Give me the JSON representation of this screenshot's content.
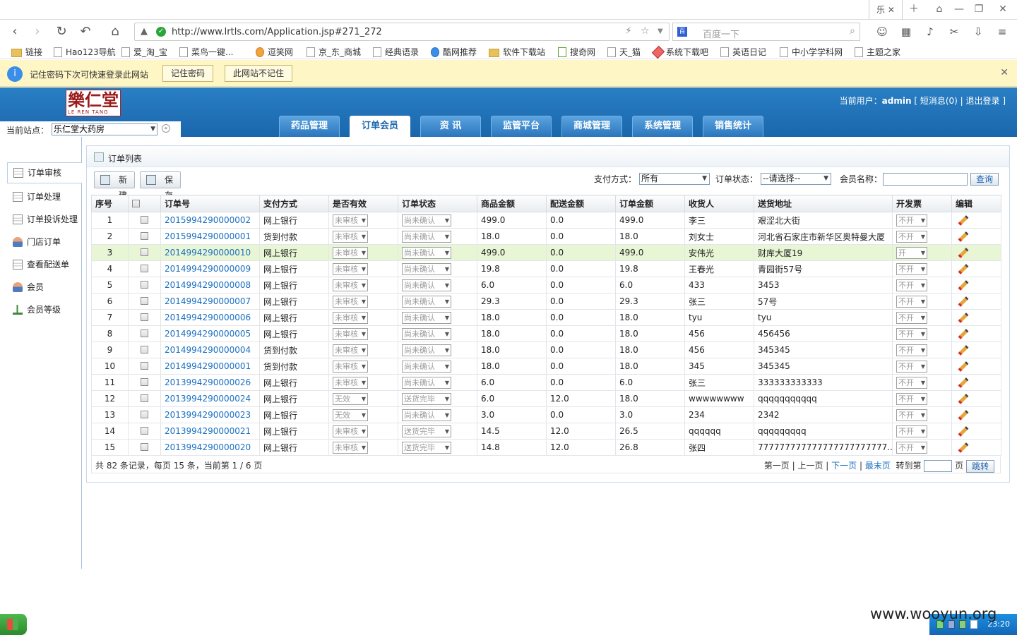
{
  "browser": {
    "tab_label": "乐",
    "url": "http://www.lrtls.com/Application.jsp#271_272",
    "search_placeholder": "百度一下",
    "bookmarks": [
      "链接",
      "Hao123导航",
      "爱_淘_宝",
      "菜鸟一键...",
      "逗笑网",
      "京_东_商城",
      "经典语录",
      "酷网推荐",
      "软件下载站",
      "搜奇网",
      "天_猫",
      "系统下载吧",
      "英语日记",
      "中小学学科网",
      "主题之家"
    ],
    "password_bar": {
      "message": "记住密码下次可快速登录此网站",
      "remember_label": "记住密码",
      "never_label": "此网站不记住"
    }
  },
  "header": {
    "logo_text": "樂仁堂",
    "logo_sub": "LE REN TANG",
    "user_prefix": "当前用户：",
    "username": "admin",
    "messages_link": "短消息(0)",
    "logout_link": "退出登录",
    "site_label": "当前站点：",
    "site_value": "乐仁堂大药房",
    "nav": [
      "药品管理",
      "订单会员",
      "资  讯",
      "监管平台",
      "商城管理",
      "系统管理",
      "销售统计"
    ]
  },
  "sidebar": {
    "items": [
      "订单审核",
      "订单处理",
      "订单投诉处理",
      "门店订单",
      "查看配送单",
      "会员",
      "会员等级"
    ]
  },
  "panel": {
    "title": "订单列表",
    "new_label": "新建",
    "save_label": "保存",
    "payment_label": "支付方式：",
    "payment_value": "所有",
    "status_label": "订单状态：",
    "status_value": "--请选择--",
    "member_label": "会员名称：",
    "query_label": "查询"
  },
  "table": {
    "columns": [
      "序号",
      "",
      "订单号",
      "支付方式",
      "是否有效",
      "订单状态",
      "商品金额",
      "配送金额",
      "订单金额",
      "收货人",
      "送货地址",
      "开发票",
      "编辑"
    ],
    "rows": [
      {
        "no": "1",
        "order": "2015994290000002",
        "pay": "网上银行",
        "valid": "未审核",
        "status": "尚未确认",
        "goods": "499.0",
        "ship": "0.0",
        "total": "499.0",
        "receiver": "李三",
        "addr": "艰涩北大街",
        "invoice": "不开"
      },
      {
        "no": "2",
        "order": "2015994290000001",
        "pay": "货到付款",
        "valid": "未审核",
        "status": "尚未确认",
        "goods": "18.0",
        "ship": "0.0",
        "total": "18.0",
        "receiver": "刘女士",
        "addr": "河北省石家庄市新华区奥特曼大厦",
        "invoice": "不开"
      },
      {
        "no": "3",
        "order": "2014994290000010",
        "pay": "网上银行",
        "valid": "未审核",
        "status": "尚未确认",
        "goods": "499.0",
        "ship": "0.0",
        "total": "499.0",
        "receiver": "安伟光",
        "addr": "财库大厦19",
        "invoice": "开"
      },
      {
        "no": "4",
        "order": "2014994290000009",
        "pay": "网上银行",
        "valid": "未审核",
        "status": "尚未确认",
        "goods": "19.8",
        "ship": "0.0",
        "total": "19.8",
        "receiver": "王春光",
        "addr": "青园街57号",
        "invoice": "不开"
      },
      {
        "no": "5",
        "order": "2014994290000008",
        "pay": "网上银行",
        "valid": "未审核",
        "status": "尚未确认",
        "goods": "6.0",
        "ship": "0.0",
        "total": "6.0",
        "receiver": "433",
        "addr": "3453",
        "invoice": "不开"
      },
      {
        "no": "6",
        "order": "2014994290000007",
        "pay": "网上银行",
        "valid": "未审核",
        "status": "尚未确认",
        "goods": "29.3",
        "ship": "0.0",
        "total": "29.3",
        "receiver": "张三",
        "addr": "57号",
        "invoice": "不开"
      },
      {
        "no": "7",
        "order": "2014994290000006",
        "pay": "网上银行",
        "valid": "未审核",
        "status": "尚未确认",
        "goods": "18.0",
        "ship": "0.0",
        "total": "18.0",
        "receiver": "tyu",
        "addr": "tyu",
        "invoice": "不开"
      },
      {
        "no": "8",
        "order": "2014994290000005",
        "pay": "网上银行",
        "valid": "未审核",
        "status": "尚未确认",
        "goods": "18.0",
        "ship": "0.0",
        "total": "18.0",
        "receiver": "456",
        "addr": "456456",
        "invoice": "不开"
      },
      {
        "no": "9",
        "order": "2014994290000004",
        "pay": "货到付款",
        "valid": "未审核",
        "status": "尚未确认",
        "goods": "18.0",
        "ship": "0.0",
        "total": "18.0",
        "receiver": "456",
        "addr": "345345",
        "invoice": "不开"
      },
      {
        "no": "10",
        "order": "2014994290000001",
        "pay": "货到付款",
        "valid": "未审核",
        "status": "尚未确认",
        "goods": "18.0",
        "ship": "0.0",
        "total": "18.0",
        "receiver": "345",
        "addr": "345345",
        "invoice": "不开"
      },
      {
        "no": "11",
        "order": "2013994290000026",
        "pay": "网上银行",
        "valid": "未审核",
        "status": "尚未确认",
        "goods": "6.0",
        "ship": "0.0",
        "total": "6.0",
        "receiver": "张三",
        "addr": "333333333333",
        "invoice": "不开"
      },
      {
        "no": "12",
        "order": "2013994290000024",
        "pay": "网上银行",
        "valid": "无效",
        "status": "送货完毕",
        "goods": "6.0",
        "ship": "12.0",
        "total": "18.0",
        "receiver": "wwwwwwww",
        "addr": "qqqqqqqqqqq",
        "invoice": "不开"
      },
      {
        "no": "13",
        "order": "2013994290000023",
        "pay": "网上银行",
        "valid": "无效",
        "status": "尚未确认",
        "goods": "3.0",
        "ship": "0.0",
        "total": "3.0",
        "receiver": "234",
        "addr": "2342",
        "invoice": "不开"
      },
      {
        "no": "14",
        "order": "2013994290000021",
        "pay": "网上银行",
        "valid": "未审核",
        "status": "送货完毕",
        "goods": "14.5",
        "ship": "12.0",
        "total": "26.5",
        "receiver": "qqqqqq",
        "addr": "qqqqqqqqq",
        "invoice": "不开"
      },
      {
        "no": "15",
        "order": "2013994290000020",
        "pay": "网上银行",
        "valid": "未审核",
        "status": "送货完毕",
        "goods": "14.8",
        "ship": "12.0",
        "total": "26.8",
        "receiver": "张四",
        "addr": "777777777777777777777777...",
        "invoice": "不开"
      }
    ]
  },
  "pager": {
    "info": "共 82 条记录，每页 15 条，当前第 1 / 6 页",
    "first": "第一页",
    "prev": "上一页",
    "next": "下一页",
    "last": "最末页",
    "goto_label": "转到第",
    "page_unit": "页",
    "jump_label": "跳转"
  },
  "taskbar": {
    "clock": "23:20"
  },
  "watermark": "www.wooyun.org"
}
